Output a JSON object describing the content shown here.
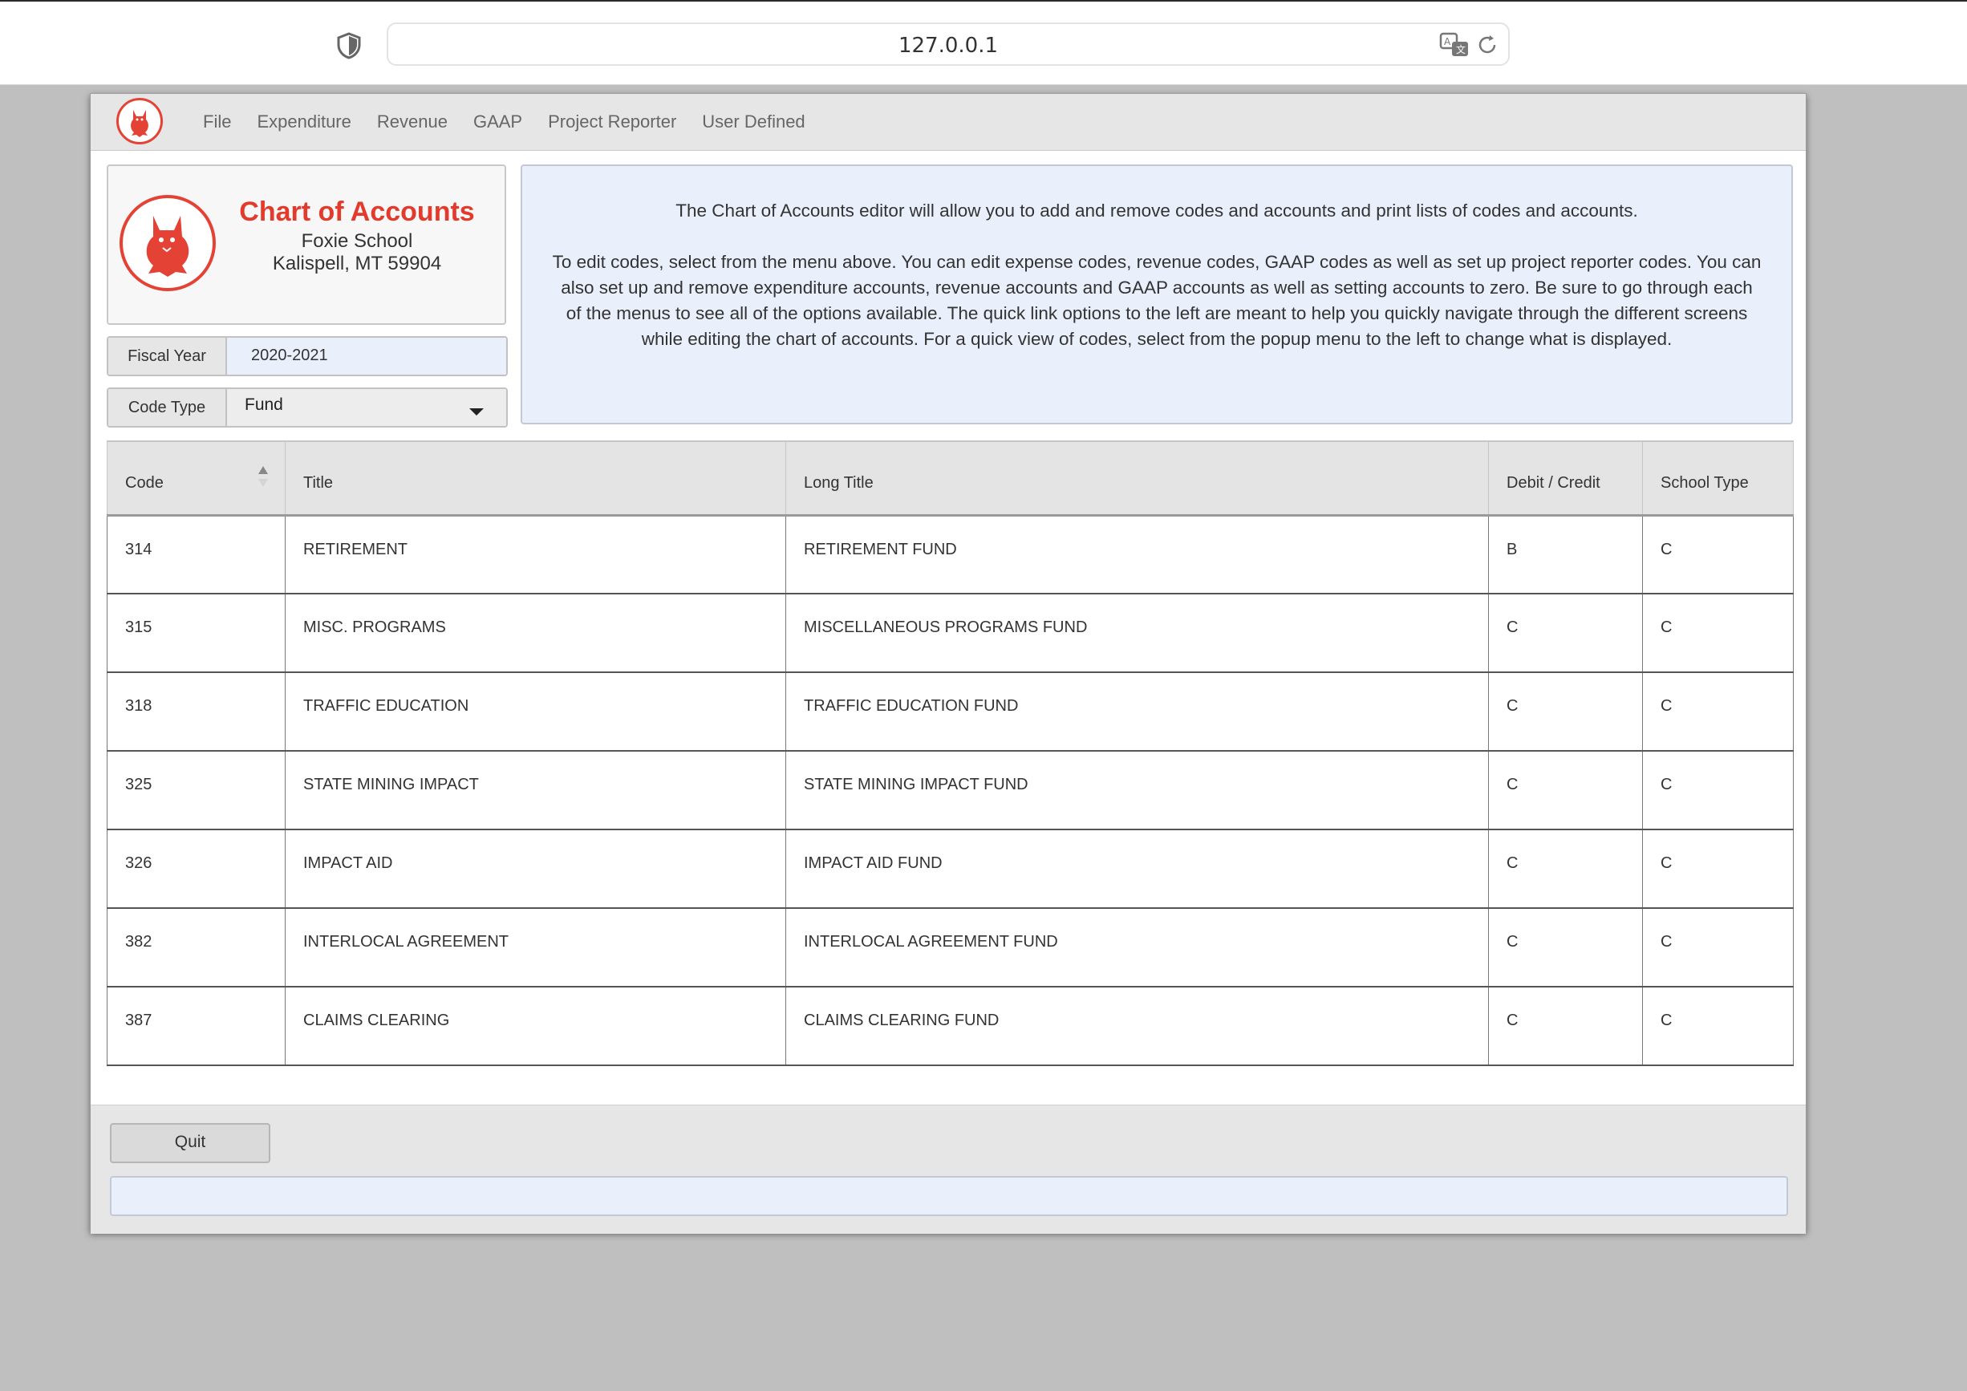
{
  "browser": {
    "url": "127.0.0.1"
  },
  "menubar": {
    "items": [
      "File",
      "Expenditure",
      "Revenue",
      "GAAP",
      "Project Reporter",
      "User Defined"
    ]
  },
  "header": {
    "title": "Chart of Accounts",
    "school": "Foxie School",
    "location": "Kalispell, MT 59904"
  },
  "fiscal_year": {
    "label": "Fiscal Year",
    "value": "2020-2021"
  },
  "code_type": {
    "label": "Code Type",
    "value": "Fund"
  },
  "info": {
    "line1": "The Chart of Accounts editor will allow you to add and remove codes and accounts and print lists of codes and accounts.",
    "line2": "To edit codes, select from the menu above.  You can edit expense codes,  revenue codes, GAAP codes as well as set up project reporter codes. You can also set up and remove expenditure accounts, revenue accounts and GAAP accounts as well as setting accounts to zero.  Be sure to go through each of the menus to see all of the options available. The quick link options to the left are meant to help you quickly navigate through the different screens while editing the chart of accounts. For a quick view of codes, select from the popup menu to the left to change what is displayed."
  },
  "table": {
    "columns": [
      "Code",
      "Title",
      "Long Title",
      "Debit / Credit",
      "School Type"
    ],
    "rows": [
      [
        "314",
        "RETIREMENT",
        "RETIREMENT FUND",
        "B",
        "C"
      ],
      [
        "315",
        "MISC. PROGRAMS",
        "MISCELLANEOUS PROGRAMS FUND",
        "C",
        "C"
      ],
      [
        "318",
        "TRAFFIC EDUCATION",
        "TRAFFIC EDUCATION FUND",
        "C",
        "C"
      ],
      [
        "325",
        "STATE MINING IMPACT",
        "STATE MINING IMPACT FUND",
        "C",
        "C"
      ],
      [
        "326",
        "IMPACT AID",
        "IMPACT AID FUND",
        "C",
        "C"
      ],
      [
        "382",
        "INTERLOCAL AGREEMENT",
        "INTERLOCAL AGREEMENT FUND",
        "C",
        "C"
      ],
      [
        "387",
        "CLAIMS CLEARING",
        "CLAIMS CLEARING FUND",
        "C",
        "C"
      ]
    ]
  },
  "footer": {
    "quit_label": "Quit",
    "status": ""
  },
  "colors": {
    "brand_red": "#e33a2c",
    "panel_blue": "#e9effb",
    "chrome_gray": "#e6e6e6",
    "desktop_gray": "#bfbfbf"
  },
  "icons": [
    "shield-icon",
    "translate-icon",
    "reload-icon",
    "fox-logo-icon",
    "sort-icon",
    "chevron-down-icon"
  ]
}
